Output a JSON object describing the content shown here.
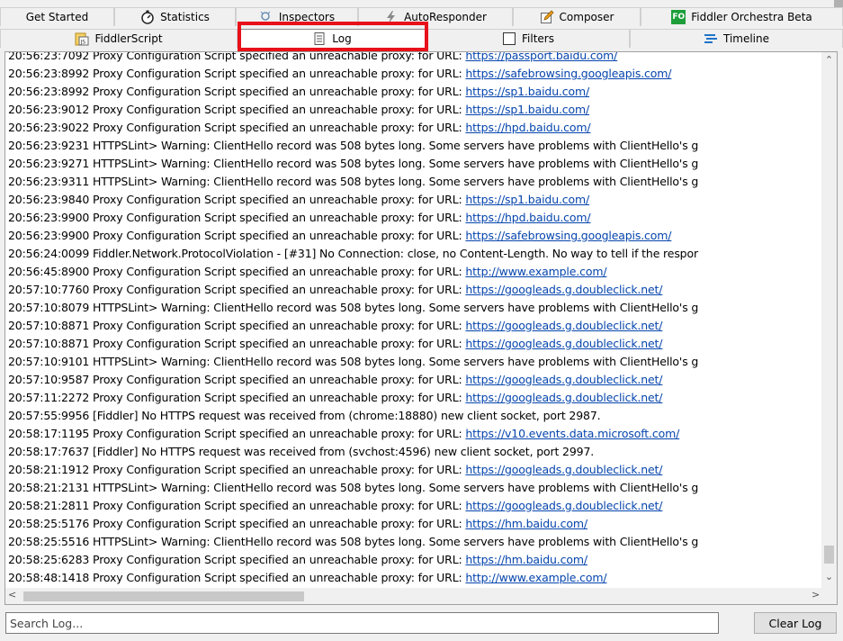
{
  "tabs_row1": [
    {
      "label": "Get Started",
      "icon": ""
    },
    {
      "label": "Statistics",
      "icon": "stopwatch-icon"
    },
    {
      "label": "Inspectors",
      "icon": "inspectors-icon"
    },
    {
      "label": "AutoResponder",
      "icon": "lightning-icon"
    },
    {
      "label": "Composer",
      "icon": "pencil-icon"
    },
    {
      "label": "Fiddler Orchestra Beta",
      "icon": "fo-icon"
    }
  ],
  "tabs_row2": [
    {
      "label": "FiddlerScript",
      "icon": "js-icon"
    },
    {
      "label": "Log",
      "icon": "document-icon"
    },
    {
      "label": "Filters",
      "icon": "checkbox-icon"
    },
    {
      "label": "Timeline",
      "icon": "timeline-icon"
    }
  ],
  "fo_icon_text": "FO",
  "js_icon_text": "JS",
  "log_lines": [
    {
      "text": "20:56:23:7092 Proxy Configuration Script specified an unreachable proxy:  for URL: ",
      "url": "https://passport.baidu.com/"
    },
    {
      "text": "20:56:23:8992 Proxy Configuration Script specified an unreachable proxy:  for URL: ",
      "url": "https://safebrowsing.googleapis.com/"
    },
    {
      "text": "20:56:23:8992 Proxy Configuration Script specified an unreachable proxy:  for URL: ",
      "url": "https://sp1.baidu.com/"
    },
    {
      "text": "20:56:23:9012 Proxy Configuration Script specified an unreachable proxy:  for URL: ",
      "url": "https://sp1.baidu.com/"
    },
    {
      "text": "20:56:23:9022 Proxy Configuration Script specified an unreachable proxy:  for URL: ",
      "url": "https://hpd.baidu.com/"
    },
    {
      "text": "20:56:23:9231 HTTPSLint> Warning: ClientHello record was 508 bytes long. Some servers have problems with ClientHello's g",
      "url": ""
    },
    {
      "text": "20:56:23:9271 HTTPSLint> Warning: ClientHello record was 508 bytes long. Some servers have problems with ClientHello's g",
      "url": ""
    },
    {
      "text": "20:56:23:9311 HTTPSLint> Warning: ClientHello record was 508 bytes long. Some servers have problems with ClientHello's g",
      "url": ""
    },
    {
      "text": "20:56:23:9840 Proxy Configuration Script specified an unreachable proxy:  for URL: ",
      "url": "https://sp1.baidu.com/"
    },
    {
      "text": "20:56:23:9900 Proxy Configuration Script specified an unreachable proxy:  for URL: ",
      "url": "https://hpd.baidu.com/"
    },
    {
      "text": "20:56:23:9900 Proxy Configuration Script specified an unreachable proxy:  for URL: ",
      "url": "https://safebrowsing.googleapis.com/"
    },
    {
      "text": "20:56:24:0099 Fiddler.Network.ProtocolViolation - [#31] No Connection: close, no Content-Length. No way to tell if the respor",
      "url": ""
    },
    {
      "text": "20:56:45:8900 Proxy Configuration Script specified an unreachable proxy:  for URL: ",
      "url": "http://www.example.com/"
    },
    {
      "text": "20:57:10:7760 Proxy Configuration Script specified an unreachable proxy:  for URL: ",
      "url": "https://googleads.g.doubleclick.net/"
    },
    {
      "text": "20:57:10:8079 HTTPSLint> Warning: ClientHello record was 508 bytes long. Some servers have problems with ClientHello's g",
      "url": ""
    },
    {
      "text": "20:57:10:8871 Proxy Configuration Script specified an unreachable proxy:  for URL: ",
      "url": "https://googleads.g.doubleclick.net/"
    },
    {
      "text": "20:57:10:8871 Proxy Configuration Script specified an unreachable proxy:  for URL: ",
      "url": "https://googleads.g.doubleclick.net/"
    },
    {
      "text": "20:57:10:9101 HTTPSLint> Warning: ClientHello record was 508 bytes long. Some servers have problems with ClientHello's g",
      "url": ""
    },
    {
      "text": "20:57:10:9587 Proxy Configuration Script specified an unreachable proxy:  for URL: ",
      "url": "https://googleads.g.doubleclick.net/"
    },
    {
      "text": "20:57:11:2272 Proxy Configuration Script specified an unreachable proxy:  for URL: ",
      "url": "https://googleads.g.doubleclick.net/"
    },
    {
      "text": "20:57:55:9956 [Fiddler] No HTTPS request was received from (chrome:18880) new client socket, port 2987.",
      "url": ""
    },
    {
      "text": "20:58:17:1195 Proxy Configuration Script specified an unreachable proxy:  for URL: ",
      "url": "https://v10.events.data.microsoft.com/"
    },
    {
      "text": "20:58:17:7637 [Fiddler] No HTTPS request was received from (svchost:4596) new client socket, port 2997.",
      "url": ""
    },
    {
      "text": "20:58:21:1912 Proxy Configuration Script specified an unreachable proxy:  for URL: ",
      "url": "https://googleads.g.doubleclick.net/"
    },
    {
      "text": "20:58:21:2131 HTTPSLint> Warning: ClientHello record was 508 bytes long. Some servers have problems with ClientHello's g",
      "url": ""
    },
    {
      "text": "20:58:21:2811 Proxy Configuration Script specified an unreachable proxy:  for URL: ",
      "url": "https://googleads.g.doubleclick.net/"
    },
    {
      "text": "20:58:25:5176 Proxy Configuration Script specified an unreachable proxy:  for URL: ",
      "url": "https://hm.baidu.com/"
    },
    {
      "text": "20:58:25:5516 HTTPSLint> Warning: ClientHello record was 508 bytes long. Some servers have problems with ClientHello's g",
      "url": ""
    },
    {
      "text": "20:58:25:6283 Proxy Configuration Script specified an unreachable proxy:  for URL: ",
      "url": "https://hm.baidu.com/"
    },
    {
      "text": "20:58:48:1418 Proxy Configuration Script specified an unreachable proxy:  for URL: ",
      "url": "http://www.example.com/"
    }
  ],
  "search": {
    "placeholder": "Search Log...",
    "value": ""
  },
  "clear_button": "Clear Log",
  "colors": {
    "link": "#0645ad",
    "highlight_box": "#e8101a",
    "fo_badge": "#1e9e3a"
  }
}
